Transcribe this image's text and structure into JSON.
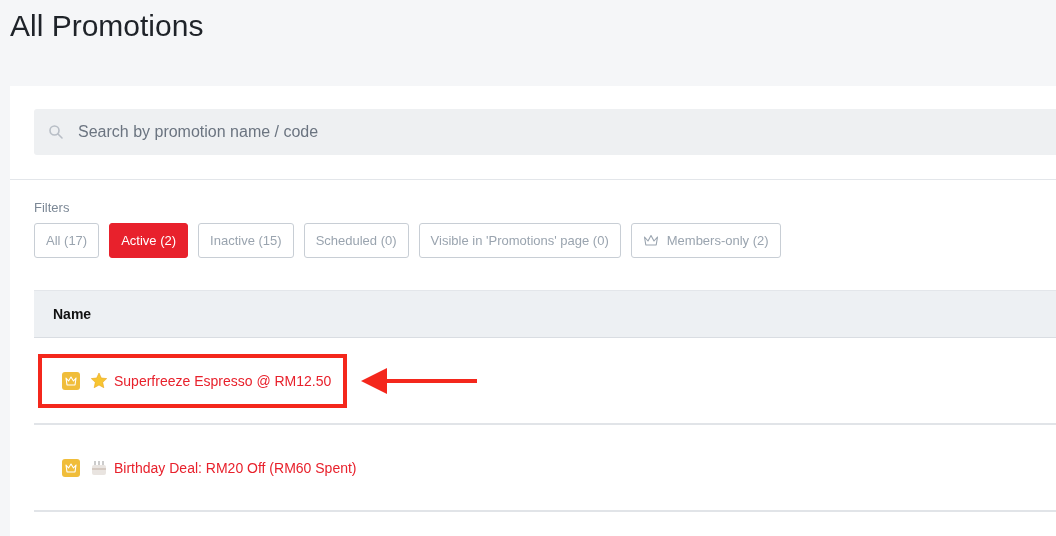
{
  "page_title": "All Promotions",
  "search": {
    "placeholder": "Search by promotion name / code"
  },
  "filters": {
    "label": "Filters",
    "items": [
      {
        "label": "All (17)",
        "selected": false
      },
      {
        "label": "Active (2)",
        "selected": true
      },
      {
        "label": "Inactive (15)",
        "selected": false
      },
      {
        "label": "Scheduled (0)",
        "selected": false
      },
      {
        "label": "Visible in 'Promotions' page (0)",
        "selected": false
      },
      {
        "label": "Members-only (2)",
        "selected": false,
        "members_icon": true
      }
    ]
  },
  "table": {
    "columns": [
      "Name"
    ],
    "rows": [
      {
        "name": "Superfreeze Espresso @ RM12.50",
        "kind": "star",
        "members_only": true,
        "highlighted": true
      },
      {
        "name": "Birthday Deal: RM20 Off (RM60 Spent)",
        "kind": "cake",
        "members_only": true,
        "highlighted": false
      }
    ]
  }
}
